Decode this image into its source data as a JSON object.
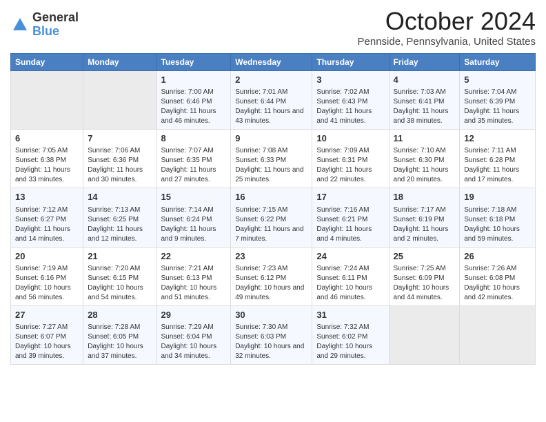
{
  "logo": {
    "general": "General",
    "blue": "Blue"
  },
  "title": "October 2024",
  "location": "Pennside, Pennsylvania, United States",
  "days_of_week": [
    "Sunday",
    "Monday",
    "Tuesday",
    "Wednesday",
    "Thursday",
    "Friday",
    "Saturday"
  ],
  "weeks": [
    [
      {
        "day": "",
        "sunrise": "",
        "sunset": "",
        "daylight": "",
        "empty": true
      },
      {
        "day": "",
        "sunrise": "",
        "sunset": "",
        "daylight": "",
        "empty": true
      },
      {
        "day": "1",
        "sunrise": "Sunrise: 7:00 AM",
        "sunset": "Sunset: 6:46 PM",
        "daylight": "Daylight: 11 hours and 46 minutes."
      },
      {
        "day": "2",
        "sunrise": "Sunrise: 7:01 AM",
        "sunset": "Sunset: 6:44 PM",
        "daylight": "Daylight: 11 hours and 43 minutes."
      },
      {
        "day": "3",
        "sunrise": "Sunrise: 7:02 AM",
        "sunset": "Sunset: 6:43 PM",
        "daylight": "Daylight: 11 hours and 41 minutes."
      },
      {
        "day": "4",
        "sunrise": "Sunrise: 7:03 AM",
        "sunset": "Sunset: 6:41 PM",
        "daylight": "Daylight: 11 hours and 38 minutes."
      },
      {
        "day": "5",
        "sunrise": "Sunrise: 7:04 AM",
        "sunset": "Sunset: 6:39 PM",
        "daylight": "Daylight: 11 hours and 35 minutes."
      }
    ],
    [
      {
        "day": "6",
        "sunrise": "Sunrise: 7:05 AM",
        "sunset": "Sunset: 6:38 PM",
        "daylight": "Daylight: 11 hours and 33 minutes."
      },
      {
        "day": "7",
        "sunrise": "Sunrise: 7:06 AM",
        "sunset": "Sunset: 6:36 PM",
        "daylight": "Daylight: 11 hours and 30 minutes."
      },
      {
        "day": "8",
        "sunrise": "Sunrise: 7:07 AM",
        "sunset": "Sunset: 6:35 PM",
        "daylight": "Daylight: 11 hours and 27 minutes."
      },
      {
        "day": "9",
        "sunrise": "Sunrise: 7:08 AM",
        "sunset": "Sunset: 6:33 PM",
        "daylight": "Daylight: 11 hours and 25 minutes."
      },
      {
        "day": "10",
        "sunrise": "Sunrise: 7:09 AM",
        "sunset": "Sunset: 6:31 PM",
        "daylight": "Daylight: 11 hours and 22 minutes."
      },
      {
        "day": "11",
        "sunrise": "Sunrise: 7:10 AM",
        "sunset": "Sunset: 6:30 PM",
        "daylight": "Daylight: 11 hours and 20 minutes."
      },
      {
        "day": "12",
        "sunrise": "Sunrise: 7:11 AM",
        "sunset": "Sunset: 6:28 PM",
        "daylight": "Daylight: 11 hours and 17 minutes."
      }
    ],
    [
      {
        "day": "13",
        "sunrise": "Sunrise: 7:12 AM",
        "sunset": "Sunset: 6:27 PM",
        "daylight": "Daylight: 11 hours and 14 minutes."
      },
      {
        "day": "14",
        "sunrise": "Sunrise: 7:13 AM",
        "sunset": "Sunset: 6:25 PM",
        "daylight": "Daylight: 11 hours and 12 minutes."
      },
      {
        "day": "15",
        "sunrise": "Sunrise: 7:14 AM",
        "sunset": "Sunset: 6:24 PM",
        "daylight": "Daylight: 11 hours and 9 minutes."
      },
      {
        "day": "16",
        "sunrise": "Sunrise: 7:15 AM",
        "sunset": "Sunset: 6:22 PM",
        "daylight": "Daylight: 11 hours and 7 minutes."
      },
      {
        "day": "17",
        "sunrise": "Sunrise: 7:16 AM",
        "sunset": "Sunset: 6:21 PM",
        "daylight": "Daylight: 11 hours and 4 minutes."
      },
      {
        "day": "18",
        "sunrise": "Sunrise: 7:17 AM",
        "sunset": "Sunset: 6:19 PM",
        "daylight": "Daylight: 11 hours and 2 minutes."
      },
      {
        "day": "19",
        "sunrise": "Sunrise: 7:18 AM",
        "sunset": "Sunset: 6:18 PM",
        "daylight": "Daylight: 10 hours and 59 minutes."
      }
    ],
    [
      {
        "day": "20",
        "sunrise": "Sunrise: 7:19 AM",
        "sunset": "Sunset: 6:16 PM",
        "daylight": "Daylight: 10 hours and 56 minutes."
      },
      {
        "day": "21",
        "sunrise": "Sunrise: 7:20 AM",
        "sunset": "Sunset: 6:15 PM",
        "daylight": "Daylight: 10 hours and 54 minutes."
      },
      {
        "day": "22",
        "sunrise": "Sunrise: 7:21 AM",
        "sunset": "Sunset: 6:13 PM",
        "daylight": "Daylight: 10 hours and 51 minutes."
      },
      {
        "day": "23",
        "sunrise": "Sunrise: 7:23 AM",
        "sunset": "Sunset: 6:12 PM",
        "daylight": "Daylight: 10 hours and 49 minutes."
      },
      {
        "day": "24",
        "sunrise": "Sunrise: 7:24 AM",
        "sunset": "Sunset: 6:11 PM",
        "daylight": "Daylight: 10 hours and 46 minutes."
      },
      {
        "day": "25",
        "sunrise": "Sunrise: 7:25 AM",
        "sunset": "Sunset: 6:09 PM",
        "daylight": "Daylight: 10 hours and 44 minutes."
      },
      {
        "day": "26",
        "sunrise": "Sunrise: 7:26 AM",
        "sunset": "Sunset: 6:08 PM",
        "daylight": "Daylight: 10 hours and 42 minutes."
      }
    ],
    [
      {
        "day": "27",
        "sunrise": "Sunrise: 7:27 AM",
        "sunset": "Sunset: 6:07 PM",
        "daylight": "Daylight: 10 hours and 39 minutes."
      },
      {
        "day": "28",
        "sunrise": "Sunrise: 7:28 AM",
        "sunset": "Sunset: 6:05 PM",
        "daylight": "Daylight: 10 hours and 37 minutes."
      },
      {
        "day": "29",
        "sunrise": "Sunrise: 7:29 AM",
        "sunset": "Sunset: 6:04 PM",
        "daylight": "Daylight: 10 hours and 34 minutes."
      },
      {
        "day": "30",
        "sunrise": "Sunrise: 7:30 AM",
        "sunset": "Sunset: 6:03 PM",
        "daylight": "Daylight: 10 hours and 32 minutes."
      },
      {
        "day": "31",
        "sunrise": "Sunrise: 7:32 AM",
        "sunset": "Sunset: 6:02 PM",
        "daylight": "Daylight: 10 hours and 29 minutes."
      },
      {
        "day": "",
        "sunrise": "",
        "sunset": "",
        "daylight": "",
        "empty": true
      },
      {
        "day": "",
        "sunrise": "",
        "sunset": "",
        "daylight": "",
        "empty": true
      }
    ]
  ]
}
